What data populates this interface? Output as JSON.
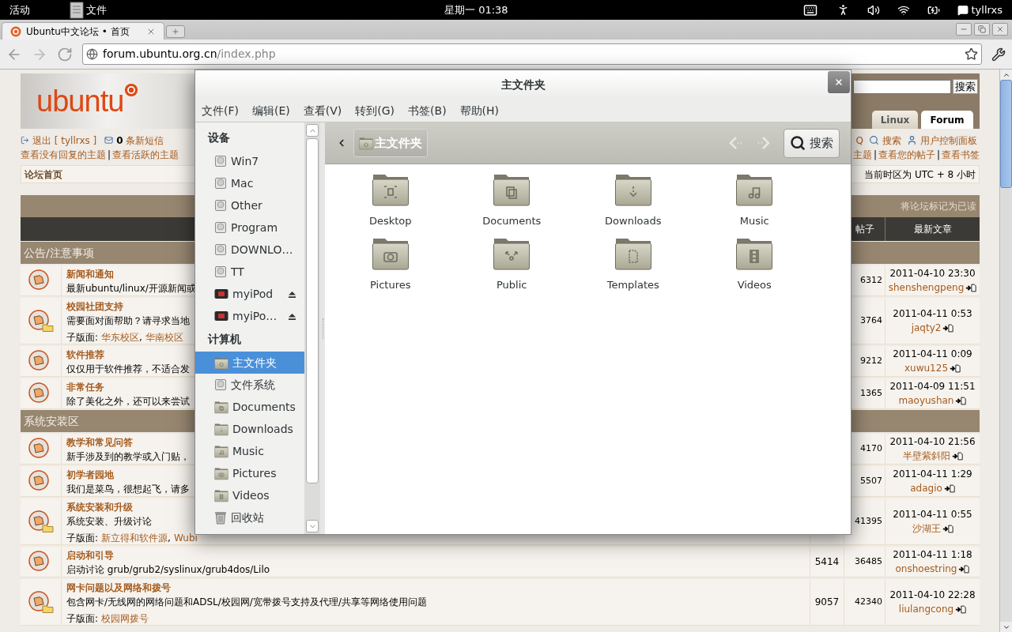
{
  "top_bar": {
    "activities": "活动",
    "app_menu": "文件",
    "clock": "星期一 01:38",
    "user": "tyllrxs"
  },
  "browser": {
    "tab_title": "Ubuntu中文论坛 • 首页",
    "url_host": "forum.ubuntu.org.cn",
    "url_path": "/index.php"
  },
  "forum": {
    "logo": "ubuntu",
    "search_button": "搜索",
    "tabs": [
      {
        "label": "Linux",
        "selected": false
      },
      {
        "label": "Forum",
        "selected": true
      }
    ],
    "logout": "退出 [ tyllrxs ]",
    "message_count": "0",
    "messages": "条新短信",
    "top_links": [
      {
        "kind": "plain",
        "text": "Q"
      },
      {
        "kind": "search",
        "text": "搜索"
      },
      {
        "kind": "profile",
        "text": "用户控制面板"
      }
    ],
    "separator": "|",
    "left_links": [
      "查看没有回复的主题",
      "查看活跃的主题"
    ],
    "right_links": [
      "主题",
      "查看您的帖子",
      "查看书签"
    ],
    "breadcrumb": "论坛首页",
    "timezone": "当前时区为 UTC + 8 小时",
    "mark_read": "将论坛标记为已读",
    "columns": {
      "posts": "帖子",
      "latest": "最新文章"
    },
    "subforum_separator": ",",
    "sections": [
      {
        "title": "公告/注意事项",
        "forums": [
          {
            "title": "新闻和通知",
            "description": "最新ubuntu/linux/开源新闻或",
            "posts": "6312",
            "last_time": "2011-04-10 23:30",
            "last_user": "shenshengpeng"
          },
          {
            "title": "校园社团支持",
            "description": "需要面对面帮助？请寻求当地",
            "subforum_label": "子版面:",
            "subforums": [
              "华东校区",
              "华南校区"
            ],
            "posts": "3764",
            "last_time": "2011-04-11 0:53",
            "last_user": "jaqty2"
          },
          {
            "title": "软件推荐",
            "description": "仅仅用于软件推荐，不适合发",
            "posts": "9212",
            "last_time": "2011-04-11 0:09",
            "last_user": "xuwu125"
          },
          {
            "title": "非常任务",
            "description": "除了美化之外，还可以来尝试",
            "posts": "1365",
            "last_time": "2011-04-09 11:51",
            "last_user": "maoyushan"
          }
        ]
      },
      {
        "title": "系统安装区",
        "forums": [
          {
            "title": "教学和常见问答",
            "description": "新手涉及到的教学或入门贴，",
            "posts": "4170",
            "last_time": "2011-04-10 21:56",
            "last_user": "半壁紫斜阳"
          },
          {
            "title": "初学者园地",
            "description": "我们是菜鸟，很想起飞，请多",
            "posts": "5507",
            "last_time": "2011-04-11 1:29",
            "last_user": "adagio"
          },
          {
            "title": "系统安装和升级",
            "description": "系统安装、升级讨论",
            "subforum_label": "子版面:",
            "subforums": [
              "新立得和软件源",
              "Wubi"
            ],
            "posts": "41395",
            "last_time": "2011-04-11 0:55",
            "last_user": "沙湖王"
          },
          {
            "title": "启动和引导",
            "description": "启动讨论 grub/grub2/syslinux/grub4dos/Lilo",
            "topics": "5414",
            "posts": "36485",
            "last_time": "2011-04-11 1:18",
            "last_user": "onshoestring"
          },
          {
            "title": "网卡问题以及网络和拨号",
            "description": "包含网卡/无线网的网络问题和ADSL/校园网/宽带拨号支持及代理/共享等网络使用问题",
            "subforum_label": "子版面:",
            "subforums": [
              "校园网拨号"
            ],
            "topics": "9057",
            "posts": "42340",
            "last_time": "2011-04-10 22:28",
            "last_user": "liulangcong"
          }
        ]
      }
    ]
  },
  "file_manager": {
    "title": "主文件夹",
    "menu": [
      "文件(F)",
      "编辑(E)",
      "查看(V)",
      "转到(G)",
      "书签(B)",
      "帮助(H)"
    ],
    "sidebar": [
      {
        "title": "设备",
        "items": [
          {
            "label": "Win7",
            "kind": "drive",
            "eject": false,
            "selected": false
          },
          {
            "label": "Mac",
            "kind": "drive",
            "eject": false,
            "selected": false
          },
          {
            "label": "Other",
            "kind": "drive",
            "eject": false,
            "selected": false
          },
          {
            "label": "Program",
            "kind": "drive",
            "eject": false,
            "selected": false
          },
          {
            "label": "DOWNLO…",
            "kind": "drive",
            "eject": false,
            "selected": false
          },
          {
            "label": "TT",
            "kind": "drive",
            "eject": false,
            "selected": false
          },
          {
            "label": "myiPod",
            "kind": "ipod",
            "eject": true,
            "selected": false
          },
          {
            "label": "myiPo…",
            "kind": "ipod",
            "eject": true,
            "selected": false
          }
        ]
      },
      {
        "title": "计算机",
        "items": [
          {
            "label": "主文件夹",
            "kind": "home",
            "eject": false,
            "selected": true
          },
          {
            "label": "文件系统",
            "kind": "drive",
            "eject": false,
            "selected": false
          },
          {
            "label": "Documents",
            "kind": "documents",
            "eject": false,
            "selected": false
          },
          {
            "label": "Downloads",
            "kind": "downloads",
            "eject": false,
            "selected": false
          },
          {
            "label": "Music",
            "kind": "music",
            "eject": false,
            "selected": false
          },
          {
            "label": "Pictures",
            "kind": "pictures",
            "eject": false,
            "selected": false
          },
          {
            "label": "Videos",
            "kind": "videos",
            "eject": false,
            "selected": false
          },
          {
            "label": "回收站",
            "kind": "trash",
            "eject": false,
            "selected": false
          }
        ]
      }
    ],
    "path": "主文件夹",
    "search": "搜索",
    "folders": [
      {
        "label": "Desktop",
        "kind": "desktop"
      },
      {
        "label": "Documents",
        "kind": "documents"
      },
      {
        "label": "Downloads",
        "kind": "downloads"
      },
      {
        "label": "Music",
        "kind": "music"
      },
      {
        "label": "Pictures",
        "kind": "pictures"
      },
      {
        "label": "Public",
        "kind": "public"
      },
      {
        "label": "Templates",
        "kind": "templates"
      },
      {
        "label": "Videos",
        "kind": "videos"
      }
    ]
  }
}
